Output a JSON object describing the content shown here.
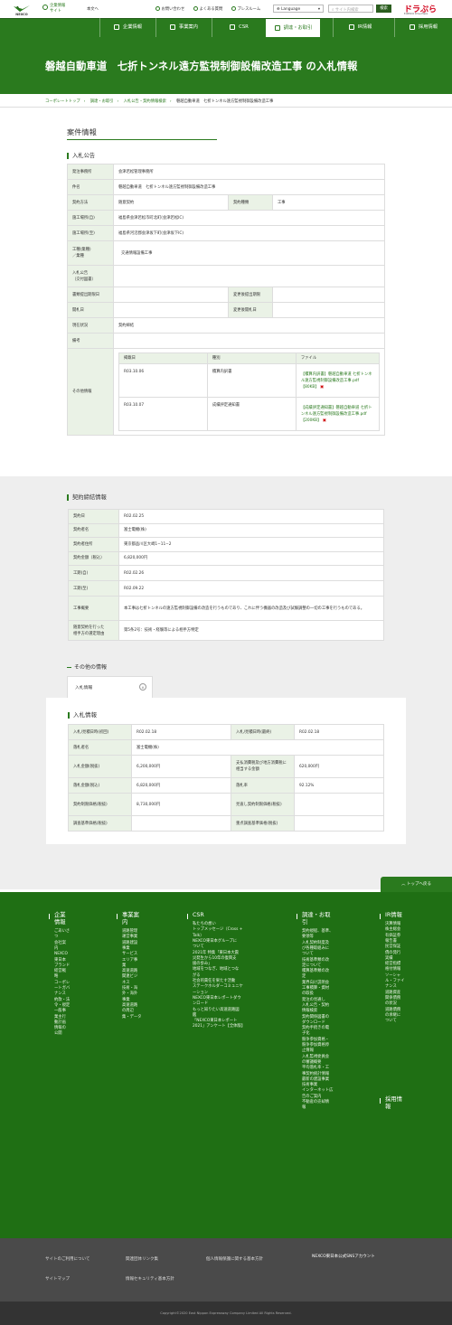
{
  "header": {
    "logo_text": "NEXCO",
    "logo_sub": "東日本",
    "corp_label": "企業情報\nサイト",
    "kiji_link": "本文へ",
    "util_links": [
      "お問い合わせ",
      "よくある質問",
      "プレスルーム"
    ],
    "language": "Language",
    "search_placeholder": "サイト内検索",
    "search_button": "検索",
    "drapla_title": "ドラぷら",
    "drapla_sub": "E-NEXCO Drive Plaza"
  },
  "nav": [
    {
      "label": "企業情報",
      "icon": "building-icon"
    },
    {
      "label": "事業案内",
      "icon": "road-icon"
    },
    {
      "label": "CSR",
      "icon": "heart-icon"
    },
    {
      "label": "調達・お取引",
      "icon": "handshake-icon",
      "active": true
    },
    {
      "label": "IR情報",
      "icon": "chart-icon"
    },
    {
      "label": "採用情報",
      "icon": "person-icon"
    }
  ],
  "hero_title": "磐越自動車道　七折トンネル遠方監視制御設備改造工事 の入札情報",
  "breadcrumb": [
    "コーポレートトップ",
    "調達・お取引",
    "入札公告・契約情報検索",
    "磐越自動車道　七折トンネル遠方監視制御設備改造工事"
  ],
  "sec1": {
    "title": "案件情報",
    "sub": "入札公告",
    "rows": {
      "orderer_label": "発注事務所",
      "orderer": "会津若松管理事務所",
      "name_label": "件名",
      "name": "磐越自動車道　七折トンネル遠方監視制御設備改造工事",
      "method_label": "契約方法",
      "method": "随意契約",
      "type_label": "契約種類",
      "type": "工事",
      "from_label": "施工場所(自)",
      "from": "福島県会津若松市町北町(会津若松IC)",
      "to_label": "施工場所(至)",
      "to": "福島県河沼郡会津坂下町(会津坂下IC)",
      "category_label": "工種(業種)\n／業種",
      "category": "交通情報設備工事",
      "notice_label": "入札公告\n（交付図書）",
      "doc_deadline_label": "書類提出期限日",
      "doc_change_label": "変更後提出期限",
      "open_label": "開札日",
      "open_change_label": "変更後開札日",
      "status_label": "現在状況",
      "status": "契約締結",
      "remarks_label": "備考",
      "other_label": "その他情報"
    },
    "files": {
      "headers": [
        "掲載日",
        "種別",
        "ファイル"
      ],
      "rows": [
        {
          "date": "R03.10.06",
          "kind": "積算内訳書",
          "file": "【積算内訳書】磐越自動車道 七折トンネル遠方監視制御設備改造工事.pdf【80KB】"
        },
        {
          "date": "R03.10.07",
          "kind": "成績評定通知書",
          "file": "【成績評定通知書】磐越自動車道 七折トンネル遠方監視制御設備改造工事.pdf【200KB】"
        }
      ]
    }
  },
  "sec2": {
    "sub": "契約締結情報",
    "rows": [
      {
        "label": "契約日",
        "value": "R02.02.25"
      },
      {
        "label": "契約者名",
        "value": "富士電機(株)"
      },
      {
        "label": "契約者住所",
        "value": "東京都品川区大崎1−11−2"
      },
      {
        "label": "契約金額（税込）",
        "value": "6,820,000円"
      },
      {
        "label": "工期(自)",
        "value": "R02.02.26"
      },
      {
        "label": "工期(至)",
        "value": "R02.09.22"
      },
      {
        "label": "工事概要",
        "value": "本工事は七折トンネルの遠方監視制御設備の改造を行うものであり、これに伴う機器の改造及び試験調整の一切の工事を行うものである。"
      },
      {
        "label": "随意契約を行った\n相手方の選定理由",
        "value": "第5条2号：技術・経験等による相手方特定"
      }
    ]
  },
  "sec3": {
    "sub": "その他の情報",
    "tab": "入札情報",
    "box_sub": "入札情報",
    "rows": {
      "bid_first_label": "入札/見積日時(初回)",
      "bid_first": "R02.02.18",
      "bid_last_label": "入札/見積日時(最終)",
      "bid_last": "R02.02.18",
      "winner_label": "落札者名",
      "winner": "富士電機(株)",
      "bid_amount_label": "入札金額(税抜)",
      "bid_amount": "6,200,000円",
      "tax_label": "支払消費税及び地方消費税に相当する金額",
      "tax": "620,000円",
      "win_amount_label": "落札金額(税込)",
      "win_amount": "6,820,000円",
      "rate_label": "落札率",
      "rate": "92.12%",
      "limit_label": "契約制限価格(税抜)",
      "limit": "8,730,000円",
      "revised_label": "見直し契約制限価格(税抜)",
      "survey_label": "調査基準価格(税抜)",
      "survey_re_label": "重点調査基準価格(税抜)"
    }
  },
  "totop": "トップへ戻る",
  "footer": {
    "cols": [
      {
        "head": [
          "企業",
          "情報"
        ],
        "items": [
          "ごあいさ",
          "つ",
          "会社案",
          "内",
          "NEXCO",
          "東日本",
          "ブランド",
          "経営戦",
          "略",
          "コーポレ",
          "ートガバ",
          "ナンス",
          "約款・法",
          "令・規定",
          "一般事",
          "業主行",
          "動計画",
          "情報の",
          "公開"
        ]
      },
      {
        "head": [
          "事業案",
          "内"
        ],
        "items": [
          "道路管理",
          "運営事業",
          "道路建設",
          "事業",
          "サービス",
          "エリア事",
          "業",
          "高速道路",
          "関連ビジ",
          "ネス",
          "技術・海",
          "外・海外",
          "事業",
          "高速道路",
          "の周辺",
          "集・データ"
        ]
      },
      {
        "head": [
          "CSR"
        ],
        "items": [
          "私たちの想い",
          "トップメッセージ（Cross +",
          "Talk）",
          "NEXCO東日本グループに",
          "ついて",
          "2021年 特集「東日本大震",
          "災発生から10年の復興支",
          "援の歩み」",
          "地域をつなぎ、地域とつな",
          "がる",
          "社会的責任を果たす活動",
          "ステークホルダーコミュニケ",
          "ーション",
          "NEXCO東日本レポートダウ",
          "ンロード",
          "もっと知りたい高速道路図",
          "鑑",
          "「NEXCO東日本レポート",
          "2021」アンケート【全体版】"
        ]
      },
      {
        "head": [
          "調達・お取",
          "引"
        ],
        "items": [
          "契約規程、基準、",
          "要領等",
          "入札契約制度及",
          "び各種取組みに",
          "ついて",
          "技術基準類の改",
          "定について",
          "積算基準類の改",
          "定",
          "業界向け説明会",
          "工事積算・資材",
          "の取扱",
          "発注の見通し",
          "入札公告・契約",
          "情報検索",
          "契約関係図書の",
          "ダウンロード",
          "契約手続きの電",
          "子化",
          "競争参加資格・",
          "競争参加資格停",
          "止情報",
          "入札監視委員会",
          "の審議概要",
          "平均落札率・工",
          "事契約統計情報",
          "最新の建設事業",
          "技術事業",
          "インターネット広",
          "告のご案内",
          "不動産の売却情",
          "報"
        ]
      },
      {
        "head": [
          "IR情報"
        ],
        "items": [
          "決算情報",
          "株主総会",
          "有価証券",
          "報告書",
          "民営保証",
          "債の発行",
          "実績",
          "経営指標",
          "格付情報",
          "ソーシャ",
          "ル・ファイ",
          "ナンス",
          "道路資産",
          "関係債務",
          "の状況",
          "道路債務",
          "の承継に",
          "ついて"
        ]
      },
      {
        "head": [
          "採用情",
          "報"
        ],
        "items": []
      }
    ]
  },
  "subfooter": {
    "links": [
      "サイトのご利用について",
      "関連団体リンク集",
      "個人情報保護に関する基本方針",
      "サイトマップ",
      "情報セキュリティ基本方針"
    ],
    "sns": "NEXCO東日本公式SNSアカウント"
  },
  "copyright": "Copyright©2020 East Nippon Expressway Company Limited All Rights Reserved."
}
